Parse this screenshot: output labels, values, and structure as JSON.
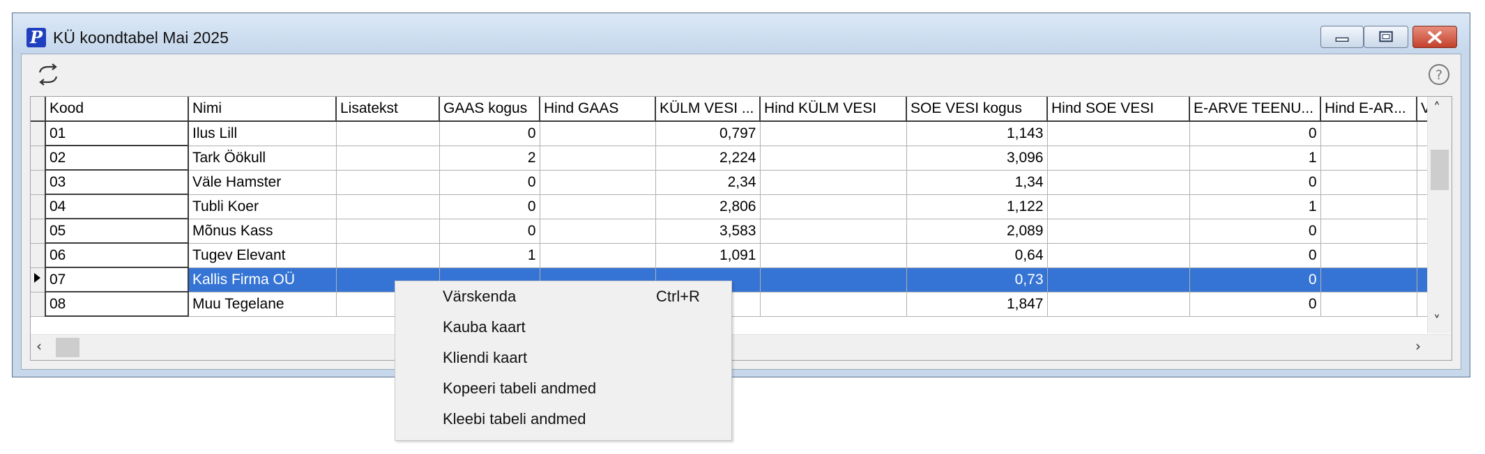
{
  "window": {
    "title": "KÜ koondtabel Mai 2025",
    "app_icon": "P"
  },
  "toolbar": {
    "refresh_icon": "refresh-icon",
    "help_icon": "help-icon"
  },
  "table": {
    "columns": [
      "Kood",
      "Nimi",
      "Lisatekst",
      "GAAS kogus",
      "Hind GAAS",
      "KÜLM VESI ...",
      "Hind KÜLM VESI",
      "SOE VESI kogus",
      "Hind SOE VESI",
      "E-ARVE TEENU...",
      "Hind E-AR...",
      "VA"
    ],
    "rows": [
      {
        "kood": "01",
        "nimi": "Ilus Lill",
        "lisatekst": "",
        "gaas": "0",
        "hind_gaas": "",
        "kulm": "0,797",
        "hind_kulm": "",
        "soe": "1,143",
        "hind_soe": "",
        "earve": "0",
        "hind_earve": "",
        "va": ""
      },
      {
        "kood": "02",
        "nimi": "Tark Öökull",
        "lisatekst": "",
        "gaas": "2",
        "hind_gaas": "",
        "kulm": "2,224",
        "hind_kulm": "",
        "soe": "3,096",
        "hind_soe": "",
        "earve": "1",
        "hind_earve": "",
        "va": ""
      },
      {
        "kood": "03",
        "nimi": "Väle Hamster",
        "lisatekst": "",
        "gaas": "0",
        "hind_gaas": "",
        "kulm": "2,34",
        "hind_kulm": "",
        "soe": "1,34",
        "hind_soe": "",
        "earve": "0",
        "hind_earve": "",
        "va": ""
      },
      {
        "kood": "04",
        "nimi": "Tubli Koer",
        "lisatekst": "",
        "gaas": "0",
        "hind_gaas": "",
        "kulm": "2,806",
        "hind_kulm": "",
        "soe": "1,122",
        "hind_soe": "",
        "earve": "1",
        "hind_earve": "",
        "va": ""
      },
      {
        "kood": "05",
        "nimi": "Mõnus Kass",
        "lisatekst": "",
        "gaas": "0",
        "hind_gaas": "",
        "kulm": "3,583",
        "hind_kulm": "",
        "soe": "2,089",
        "hind_soe": "",
        "earve": "0",
        "hind_earve": "",
        "va": ""
      },
      {
        "kood": "06",
        "nimi": "Tugev Elevant",
        "lisatekst": "",
        "gaas": "1",
        "hind_gaas": "",
        "kulm": "1,091",
        "hind_kulm": "",
        "soe": "0,64",
        "hind_soe": "",
        "earve": "0",
        "hind_earve": "",
        "va": ""
      },
      {
        "kood": "07",
        "nimi": "Kallis Firma OÜ",
        "lisatekst": "",
        "gaas": "",
        "hind_gaas": "",
        "kulm": "",
        "hind_kulm": "",
        "soe": "0,73",
        "hind_soe": "",
        "earve": "0",
        "hind_earve": "",
        "va": ""
      },
      {
        "kood": "08",
        "nimi": "Muu Tegelane",
        "lisatekst": "",
        "gaas": "",
        "hind_gaas": "",
        "kulm": "",
        "hind_kulm": "",
        "soe": "1,847",
        "hind_soe": "",
        "earve": "0",
        "hind_earve": "",
        "va": ""
      }
    ],
    "selected_row": "07",
    "selection_color": "#3574d4"
  },
  "context_menu": {
    "items": [
      {
        "label": "Värskenda",
        "shortcut": "Ctrl+R"
      },
      {
        "label": "Kauba kaart",
        "shortcut": ""
      },
      {
        "label": "Kliendi kaart",
        "shortcut": ""
      },
      {
        "label": "Kopeeri tabeli andmed",
        "shortcut": ""
      },
      {
        "label": "Kleebi tabeli andmed",
        "shortcut": ""
      }
    ]
  }
}
